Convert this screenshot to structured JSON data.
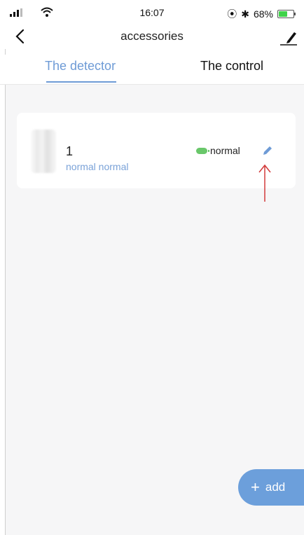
{
  "status_bar": {
    "time": "16:07",
    "battery": "68%",
    "battery_level": 0.68,
    "icons": [
      "signal-icon",
      "wifi-icon",
      "orientation-lock-icon",
      "bluetooth-icon",
      "battery-icon"
    ]
  },
  "nav": {
    "title": "accessories",
    "back_icon": "chevron-left-icon",
    "edit_icon": "edit-pencil-icon"
  },
  "tabs": [
    {
      "label": "The detector",
      "active": true
    },
    {
      "label": "The control",
      "active": false
    }
  ],
  "devices": [
    {
      "name": "1",
      "subtitle": "normal normal",
      "status_label": "normal",
      "status_icon": "battery-icon",
      "status_color": "#69c76a",
      "edit_icon": "pencil-icon"
    }
  ],
  "add_button": {
    "label": "add",
    "icon": "plus-icon"
  },
  "colors": {
    "accent": "#6e9bd6",
    "add_button": "#6c9fdb",
    "background": "#f6f6f7",
    "annotation_arrow": "#d23a3a"
  }
}
